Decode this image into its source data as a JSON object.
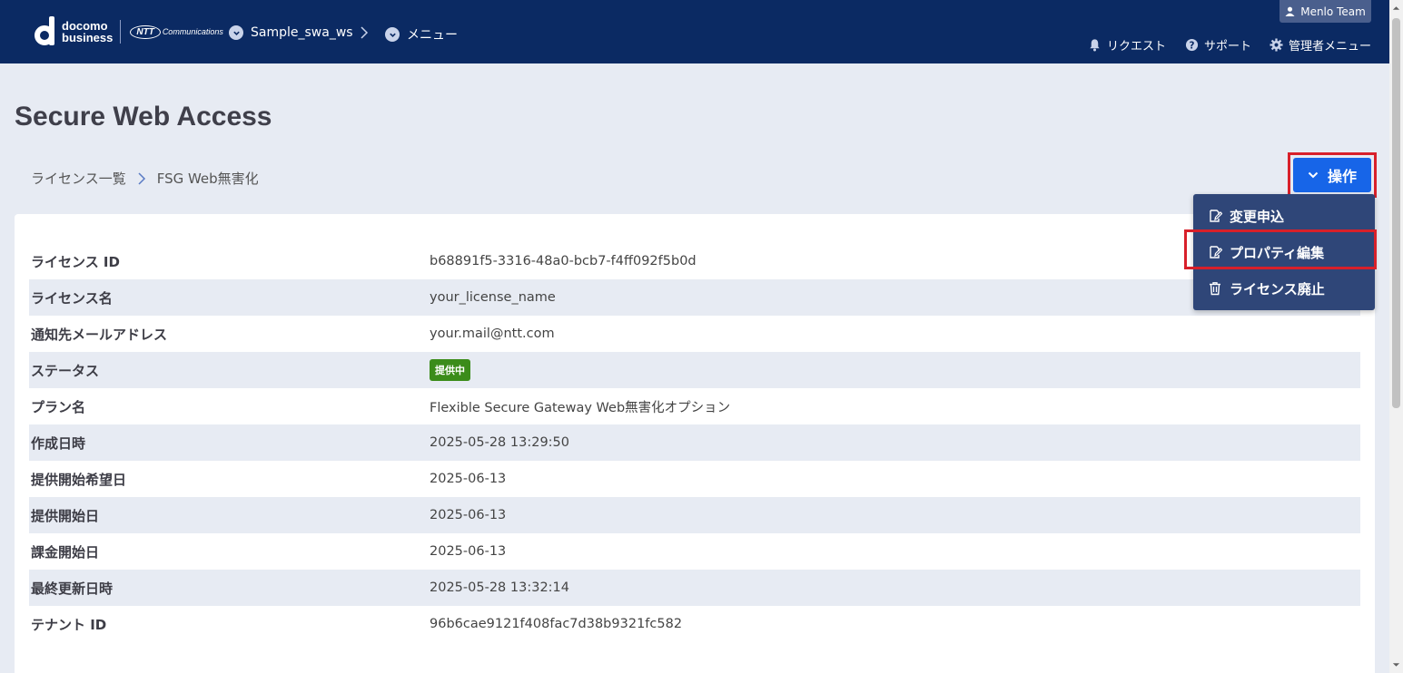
{
  "header": {
    "logo_line1": "docomo",
    "logo_line2": "business",
    "ntt_logo_bold": "NTT",
    "ntt_logo_text": "Communications",
    "workspace": "Sample_swa_ws",
    "menu": "メニュー",
    "user": "Menlo Team",
    "links": {
      "request": "リクエスト",
      "support": "サポート",
      "admin": "管理者メニュー"
    }
  },
  "page": {
    "title": "Secure Web Access",
    "breadcrumb": [
      "ライセンス一覧",
      "FSG Web無害化"
    ],
    "action_button": "操作"
  },
  "menu": {
    "items": [
      {
        "label": "変更申込",
        "icon": "edit-icon"
      },
      {
        "label": "プロパティ編集",
        "icon": "edit-icon"
      },
      {
        "label": "ライセンス廃止",
        "icon": "trash-icon"
      }
    ]
  },
  "details": [
    {
      "label": "ライセンス ID",
      "value": "b68891f5-3316-48a0-bcb7-f4ff092f5b0d"
    },
    {
      "label": "ライセンス名",
      "value": "your_license_name"
    },
    {
      "label": "通知先メールアドレス",
      "value": "your.mail@ntt.com"
    },
    {
      "label": "ステータス",
      "value": "提供中",
      "badge_color": "#3b8c1a"
    },
    {
      "label": "プラン名",
      "value": "Flexible Secure Gateway Web無害化オプション"
    },
    {
      "label": "作成日時",
      "value": "2025-05-28 13:29:50"
    },
    {
      "label": "提供開始希望日",
      "value": "2025-06-13"
    },
    {
      "label": "提供開始日",
      "value": "2025-06-13"
    },
    {
      "label": "課金開始日",
      "value": "2025-06-13"
    },
    {
      "label": "最終更新日時",
      "value": "2025-05-28 13:32:14"
    },
    {
      "label": "テナント ID",
      "value": "96b6cae9121f408fac7d38b9321fc582"
    }
  ],
  "colors": {
    "header_bg": "#0b2a63",
    "primary_button": "#1765e8",
    "menu_bg": "#2f4678",
    "highlight_border": "#d8202a"
  }
}
